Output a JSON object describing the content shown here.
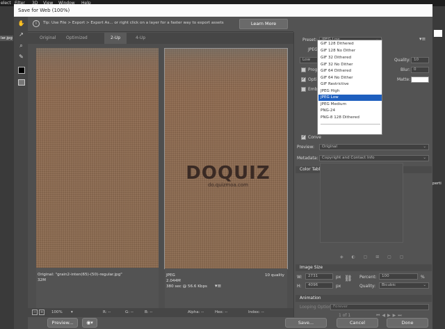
{
  "menubar": {
    "items": [
      "elect",
      "Filter",
      "3D",
      "View",
      "Window",
      "Help"
    ]
  },
  "background": {
    "left_tab": "lar.jpg",
    "right_tab": "perti"
  },
  "dialog": {
    "title": "Save for Web (100%)"
  },
  "tip": {
    "text": "Tip: Use File > Export > Export As...  or right click on a layer for a faster way to export assets",
    "learn_more": "Learn More"
  },
  "tabs": [
    "Original",
    "Optimized",
    "2-Up",
    "4-Up"
  ],
  "active_tab": "2-Up",
  "panes": {
    "left": {
      "line1": "Original: \"grain2-inten(65)-(50)-regular.jpg\"",
      "line2": "32M"
    },
    "right": {
      "line1": "JPEG",
      "line2": "2.044M",
      "line3": "380 sec @ 56.6 Kbps",
      "quality": "10 quality"
    }
  },
  "watermark": {
    "brand": "DOQUIZ",
    "url": "do.quizmoa.com"
  },
  "statusbar": {
    "zoom": "100%",
    "r": "R: --",
    "g": "G: --",
    "b": "B: --",
    "alpha": "Alpha: --",
    "hex": "Hex: --",
    "index": "Index: --"
  },
  "bottom": {
    "preview": "Preview...",
    "save": "Save...",
    "cancel": "Cancel",
    "done": "Done"
  },
  "settings": {
    "preset_label": "Preset:",
    "preset_value": "JPEG Low",
    "format_value": "JPEG",
    "quality_level": "Low",
    "quality_label": "Quality:",
    "quality_value": "10",
    "blur_label": "Blur:",
    "blur_value": "0",
    "matte_label": "Matte:",
    "progressive": "Progr",
    "optimized": "Optim",
    "embed": "Embe",
    "convert": "Conve",
    "preview_label": "Preview:",
    "preview_value": "Original",
    "metadata_label": "Metadata:",
    "metadata_value": "Copyright and Contact Info",
    "color_table": "Color Table"
  },
  "preset_options": [
    "GIF 128 Dithered",
    "GIF 128 No Dither",
    "GIF 32 Dithered",
    "GIF 32 No Dither",
    "GIF 64 Dithered",
    "GIF 64 No Dither",
    "GIF Restrictive",
    "JPEG High",
    "JPEG Low",
    "JPEG Medium",
    "PNG-24",
    "PNG-8 128 Dithered"
  ],
  "preset_selected": "JPEG Low",
  "image_size": {
    "title": "Image Size",
    "w_label": "W:",
    "w_value": "2731",
    "w_unit": "px",
    "h_label": "H:",
    "h_value": "4096",
    "h_unit": "px",
    "percent_label": "Percent:",
    "percent_value": "100",
    "percent_unit": "%",
    "quality_label": "Quality:",
    "quality_value": "Bicubic"
  },
  "animation": {
    "title": "Animation",
    "looping_label": "Looping Options:",
    "looping_value": "Forever",
    "frame": "1 of 1"
  },
  "colors": {
    "accent": "#1e5fbf",
    "panel": "#535353",
    "image": "#8b6a4f"
  }
}
